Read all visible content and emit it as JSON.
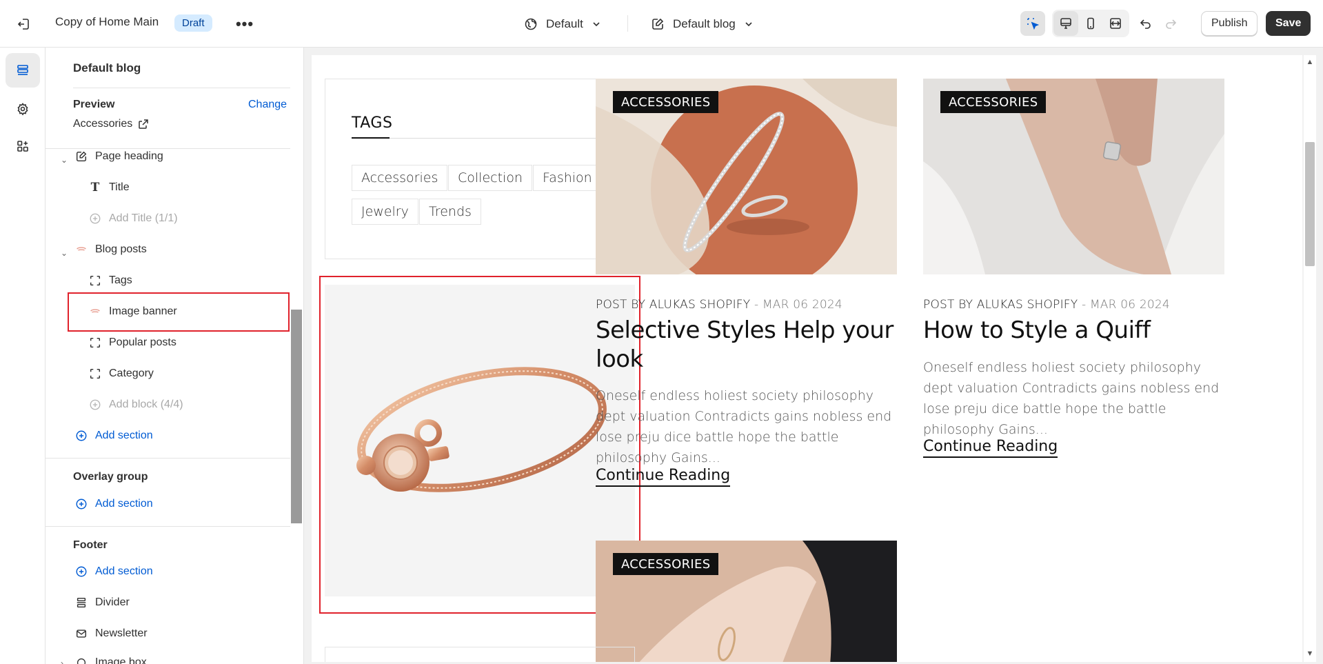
{
  "topbar": {
    "theme_title": "Copy of Home Main",
    "draft_label": "Draft",
    "more_label": "•••",
    "theme_select_label": "Default",
    "template_select_label": "Default blog",
    "publish_label": "Publish",
    "save_label": "Save"
  },
  "sidebar": {
    "heading": "Default blog",
    "preview_label": "Preview",
    "change_label": "Change",
    "preview_value": "Accessories",
    "items": [
      {
        "label": "Page heading"
      },
      {
        "label": "Title"
      },
      {
        "label": "Add Title (1/1)"
      },
      {
        "label": "Blog posts"
      },
      {
        "label": "Tags"
      },
      {
        "label": "Image banner"
      },
      {
        "label": "Popular posts"
      },
      {
        "label": "Category"
      },
      {
        "label": "Add block (4/4)"
      },
      {
        "label": "Add section"
      }
    ],
    "overlay_group": {
      "label": "Overlay group",
      "add_section": "Add section"
    },
    "footer": {
      "label": "Footer",
      "add_section": "Add section",
      "items": [
        "Divider",
        "Newsletter",
        "Image box"
      ]
    }
  },
  "canvas": {
    "tags_title": "TAGS",
    "tags": [
      "Accessories",
      "Collection",
      "Fashion",
      "Jewelry",
      "Trends"
    ],
    "posts": [
      {
        "category": "ACCESSORIES",
        "author": "POST BY ALUKAS SHOPIFY",
        "date": "- MAR 06 2024",
        "title": "Selective Styles Help your look",
        "excerpt": "Oneself endless holiest society philosophy dept valuation Contradicts gains nobless end lose preju dice battle hope the battle philosophy Gains...",
        "link": "Continue Reading"
      },
      {
        "category": "ACCESSORIES",
        "author": "POST BY ALUKAS SHOPIFY",
        "date": "- MAR 06 2024",
        "title": "How to Style a Quiff",
        "excerpt": "Oneself endless holiest society philosophy dept valuation Contradicts gains nobless end lose preju dice battle hope the battle philosophy Gains...",
        "link": "Continue Reading"
      },
      {
        "category": "ACCESSORIES"
      }
    ]
  },
  "colors": {
    "accent_blue": "#005bd3",
    "highlight_red": "#e0212b",
    "draft_bg": "#d5ebff",
    "save_bg": "#303030"
  }
}
